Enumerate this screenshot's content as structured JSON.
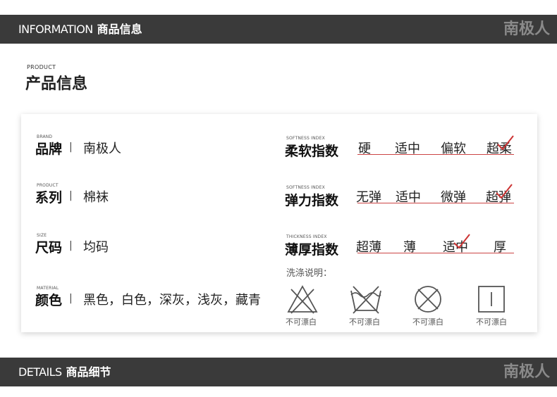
{
  "header": {
    "title_en": "INFORMATION",
    "title_cn": "商品信息",
    "logo": "南极人"
  },
  "section": {
    "label_en": "PRODUCT",
    "label_cn": "产品信息"
  },
  "attributes": [
    {
      "label_en": "BRAND",
      "label_cn": "品牌",
      "separator": "|",
      "value": "南极人"
    },
    {
      "label_en": "PRODUCT",
      "label_cn": "系列",
      "separator": "|",
      "value": "棉袜"
    },
    {
      "label_en": "SIZE",
      "label_cn": "尺码",
      "separator": "|",
      "value": "均码"
    },
    {
      "label_en": "MATERIAL",
      "label_cn": "颜色",
      "separator": "|",
      "value": "黑色，白色，深灰，浅灰，藏青"
    }
  ],
  "indices": [
    {
      "label_en": "SOFTNESS INDEX",
      "label_cn": "柔软指数",
      "options": [
        "硬",
        "适中",
        "偏软",
        "超柔"
      ],
      "selected": "超柔"
    },
    {
      "label_en": "SOFTNESS INDEX",
      "label_cn": "弹力指数",
      "options": [
        "无弹",
        "适中",
        "微弹",
        "超弹"
      ],
      "selected": "超弹"
    },
    {
      "label_en": "THICKNESS INDEX",
      "label_cn": "薄厚指数",
      "options": [
        "超薄",
        "薄",
        "适中",
        "厚"
      ],
      "selected": "适中"
    }
  ],
  "washing": {
    "label": "洗涤说明：",
    "icons": [
      {
        "icon": "no-bleach-icon",
        "caption": "不可漂白"
      },
      {
        "icon": "no-wash-icon",
        "caption": "不可漂白"
      },
      {
        "icon": "no-tumble-dry-icon",
        "caption": "不可漂白"
      },
      {
        "icon": "line-dry-icon",
        "caption": "不可漂白"
      }
    ]
  },
  "footer": {
    "title_en": "DETAILS",
    "title_cn": "商品细节",
    "logo": "南极人"
  },
  "colors": {
    "band": "#3a3a3a",
    "accent": "#cc3333",
    "logo": "#8a8a8a"
  }
}
